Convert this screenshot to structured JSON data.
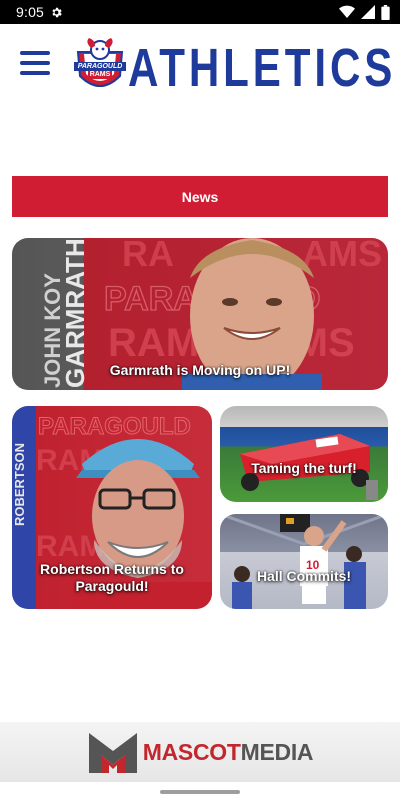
{
  "status_bar": {
    "time": "9:05",
    "icons": [
      "gear-icon",
      "wifi-icon",
      "signal-icon",
      "battery-icon"
    ]
  },
  "header": {
    "title": "ATHLETICS",
    "logo_text_top": "PARAGOULD",
    "logo_text_bottom": "RAMS",
    "menu_icon": "hamburger-menu-icon",
    "colors": {
      "brand_blue": "#1e3b9c",
      "brand_red": "#d01d34"
    }
  },
  "news_bar": {
    "label": "News"
  },
  "tiles": [
    {
      "caption": "Garmrath is Moving on UP!",
      "jersey_text": "JOHN KOY GARMRATH",
      "backdrop_text": "RAMS PARAGOULD RAMS"
    },
    {
      "caption": "Robertson Returns to Paragould!",
      "jersey_text": "ROBERTSON",
      "backdrop_text": "PARAGOULD RAMS"
    },
    {
      "caption": "Taming the turf!"
    },
    {
      "caption": "Hall Commits!"
    }
  ],
  "footer": {
    "brand_part1": "MASCOT",
    "brand_part2": "MEDIA",
    "logo_letter": "M",
    "colors": {
      "red": "#c1272d",
      "gray": "#555555"
    }
  }
}
